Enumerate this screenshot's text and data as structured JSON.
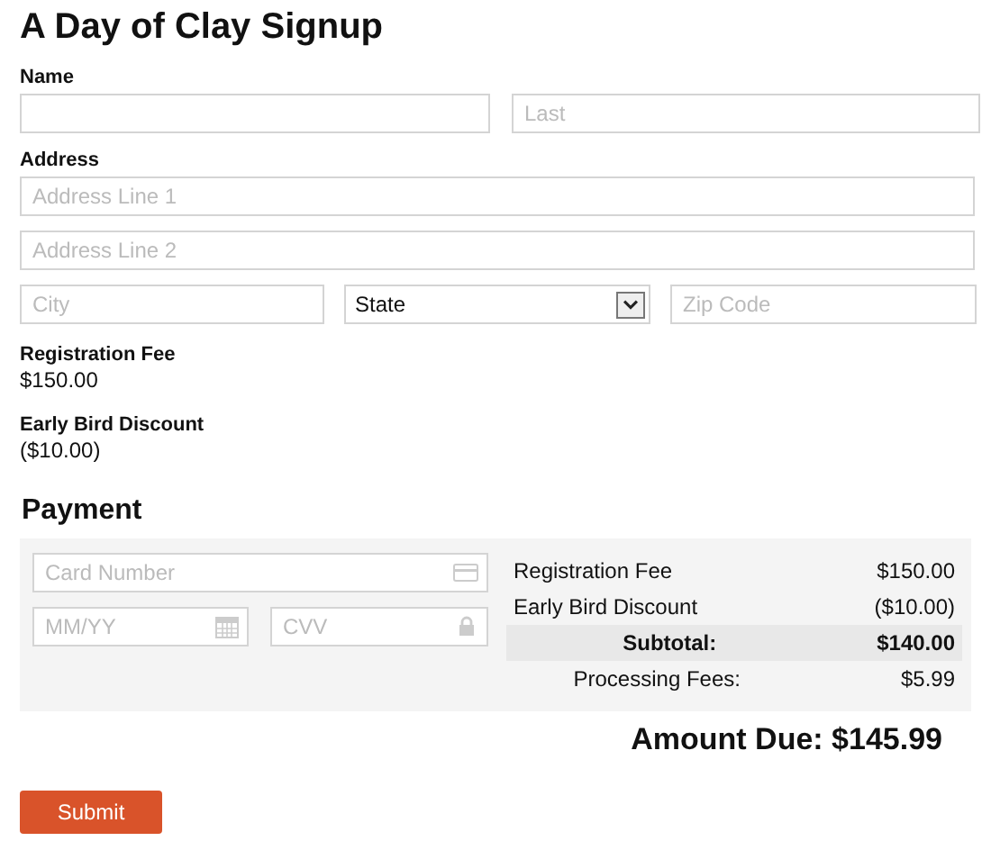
{
  "title": "A Day of Clay Signup",
  "name": {
    "label": "Name",
    "last_placeholder": "Last"
  },
  "address": {
    "label": "Address",
    "line1_placeholder": "Address Line 1",
    "line2_placeholder": "Address Line 2",
    "city_placeholder": "City",
    "state": "State",
    "zip_placeholder": "Zip Code"
  },
  "fees": [
    {
      "label": "Registration Fee",
      "amount": "$150.00"
    },
    {
      "label": "Early Bird Discount",
      "amount": "($10.00)"
    }
  ],
  "payment": {
    "title": "Payment",
    "card_placeholder": "Card Number",
    "expiry_placeholder": "MM/YY",
    "cvv_placeholder": "CVV",
    "summary": [
      {
        "kind": "line",
        "label": "Registration Fee",
        "amount": "$150.00"
      },
      {
        "kind": "line",
        "label": "Early Bird Discount",
        "amount": "($10.00)"
      },
      {
        "kind": "subtotal",
        "label": "Subtotal:",
        "amount": "$140.00"
      },
      {
        "kind": "fee",
        "label": "Processing Fees:",
        "amount": "$5.99"
      }
    ],
    "amount_due": "Amount Due: $145.99"
  },
  "submit": "Submit"
}
